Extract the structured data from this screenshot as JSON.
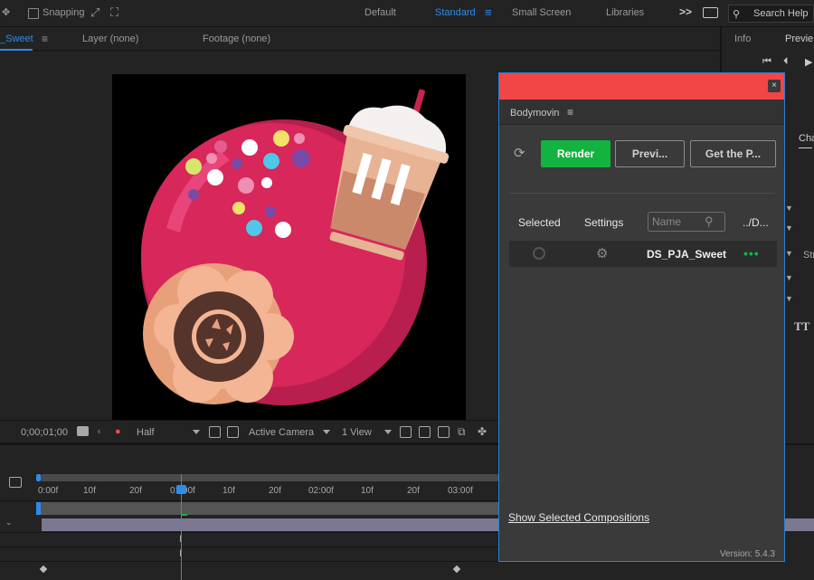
{
  "topbar": {
    "snapping_label": "Snapping",
    "workspaces": [
      "Default",
      "Standard",
      "Small Screen",
      "Libraries"
    ],
    "overflow_label": ">>",
    "search_label": "Search Help"
  },
  "comp_header": {
    "comp_tab": "_Sweet",
    "layer_tab": "Layer (none)",
    "footage_tab": "Footage (none)"
  },
  "right_panel": {
    "tab_info": "Info",
    "tab_preview": "Previe",
    "tab_character": "Cha",
    "label_str": "Str",
    "tt_label": "TT"
  },
  "viewer_toolbar": {
    "timecode": "0;00;01;00",
    "resolution": "Half",
    "camera": "Active Camera",
    "views": "1 View"
  },
  "timeline": {
    "ticks": [
      "0:00f",
      "10f",
      "20f",
      "01:00f",
      "10f",
      "20f",
      "02:00f",
      "10f",
      "20f",
      "03:00f"
    ]
  },
  "bodymovin": {
    "close_label": "×",
    "title": "Bodymovin",
    "menu_icon": "≡",
    "buttons": {
      "render": "Render",
      "preview": "Previ...",
      "get_player": "Get the P..."
    },
    "columns": {
      "selected": "Selected",
      "settings": "Settings",
      "destination": "../D..."
    },
    "name_placeholder": "Name",
    "compositions": [
      {
        "name": "DS_PJA_Sweet",
        "more": "•••"
      }
    ],
    "show_selected": "Show Selected Compositions",
    "version": "Version: 5.4.3"
  },
  "colors": {
    "accent_blue": "#2d8ceb",
    "render_green": "#13b33f",
    "titlebar_red": "#f24545"
  }
}
